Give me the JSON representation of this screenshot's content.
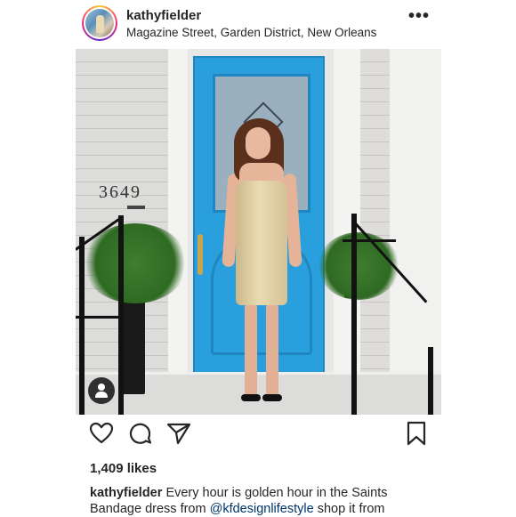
{
  "post": {
    "username": "kathyfielder",
    "location": "Magazine Street, Garden District, New Orleans",
    "more_label": "•••",
    "house_number": "3649",
    "likes": "1,409 likes",
    "caption": {
      "username": "kathyfielder",
      "line1": "Every hour is golden hour in the Saints",
      "line2_prefix": "Bandage dress from ",
      "mention": "@kfdesignlifestyle",
      "line2_suffix": " shop it from"
    }
  },
  "icons": {
    "avatar": "profile-photo",
    "more": "more-options-icon",
    "like": "heart-icon",
    "comment": "comment-bubble-icon",
    "share": "paper-plane-icon",
    "save": "bookmark-icon",
    "tagged": "tagged-person-icon"
  },
  "colors": {
    "text": "#262626",
    "mention": "#003569",
    "door": "#2a9fde"
  }
}
